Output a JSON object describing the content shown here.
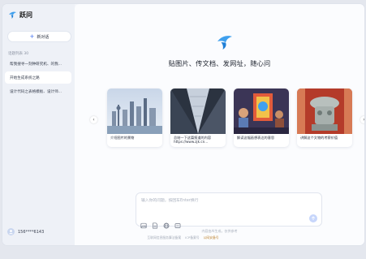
{
  "app": {
    "brand": "跃问",
    "accent": "#3b6cf0",
    "logo_color": "#3fa0ee"
  },
  "sidebar": {
    "new_chat_label": "新对话",
    "history_heading": "话题列表 30",
    "items": [
      {
        "label": "帮我搜寻一刻钟研究机、的我..."
      },
      {
        "label": "开始生成系统之路"
      },
      {
        "label": "设计代码之表格模板、设计师..."
      }
    ],
    "user_name": "156****6143"
  },
  "main": {
    "tagline": "贴图片、传文档、发网址，随心问",
    "cards": [
      {
        "caption": "介绍图片的景物",
        "pic": "city-skyline"
      },
      {
        "caption": "总结一下这篇报道的内容\nhttps://www.zjk.cn...",
        "pic": "skyscraper"
      },
      {
        "caption": "解读这幅画想表达的意思",
        "pic": "painting"
      },
      {
        "caption": "讲解这个文物的考察价值",
        "pic": "artifact"
      }
    ],
    "composer": {
      "placeholder": "输入你的问题，按回车Enter换行"
    },
    "disclaimer": "内容由AI生成，仅供参考",
    "footer": [
      "互联网信息服务算法备案",
      "ICP备案号",
      "公网安备号"
    ]
  }
}
